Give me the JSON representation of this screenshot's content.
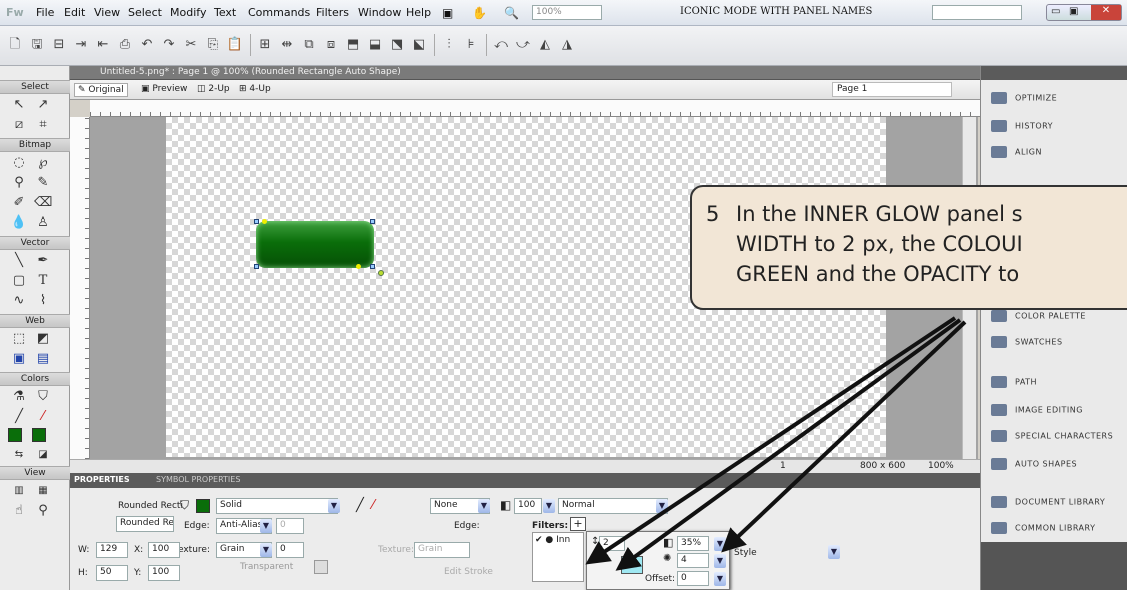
{
  "app_logo": "Fw",
  "menu": [
    "File",
    "Edit",
    "View",
    "Select",
    "Modify",
    "Text",
    "Commands",
    "Filters",
    "Window",
    "Help"
  ],
  "zoom_field": "100%",
  "workspace_mode": "ICONIC MODE WITH PANEL NAMES",
  "document_tab": "Untitled-5.png* : Page 1 @ 100% (Rounded Rectangle Auto Shape)",
  "view_tabs": [
    "Original",
    "Preview",
    "2-Up",
    "4-Up"
  ],
  "page_selector": "Page 1",
  "tools": {
    "sections": [
      "Select",
      "Bitmap",
      "Vector",
      "Web",
      "Colors",
      "View"
    ]
  },
  "status": {
    "page_num": "1",
    "canvas_size": "800 x 600",
    "zoom": "100%"
  },
  "properties": {
    "tabs": [
      "PROPERTIES",
      "SYMBOL PROPERTIES"
    ],
    "object_type": "Rounded Recti",
    "object_name": "Rounded Re",
    "fill_type": "Solid",
    "edge_label": "Edge:",
    "edge_value": "Anti-Alias",
    "edge_amount": "0",
    "texture_label": "Texture:",
    "texture_value": "Grain",
    "texture_amount": "0",
    "transparent_label": "Transparent",
    "stroke_value": "None",
    "stroke_edge_label": "Edge:",
    "stroke_texture_label": "Texture:",
    "stroke_texture_value": "Grain",
    "edit_stroke": "Edit Stroke",
    "opacity": "100",
    "blend": "Normal",
    "filters_label": "Filters:",
    "filter_item": "Inn",
    "w_label": "W:",
    "w": "129",
    "x_label": "X:",
    "x": "100",
    "h_label": "H:",
    "h": "50",
    "y_label": "Y:",
    "y": "100",
    "style_label": "Style"
  },
  "inner_glow": {
    "width": "2",
    "opacity": "35%",
    "softness": "4",
    "offset_label": "Offset:",
    "offset": "0",
    "colour": "#9fe8f2"
  },
  "panels": [
    "OPTIMIZE",
    "HISTORY",
    "ALIGN",
    "COLOR PALETTE",
    "SWATCHES",
    "PATH",
    "IMAGE EDITING",
    "SPECIAL CHARACTERS",
    "AUTO SHAPES",
    "DOCUMENT LIBRARY",
    "COMMON LIBRARY"
  ],
  "callout": {
    "number": "5",
    "text": "In the INNER GLOW panel s\nWIDTH to 2 px, the COLOUI\nGREEN and the OPACITY to"
  },
  "colors": {
    "shape_green": "#0a6e0a",
    "callout_bg": "#f2e6d6"
  }
}
